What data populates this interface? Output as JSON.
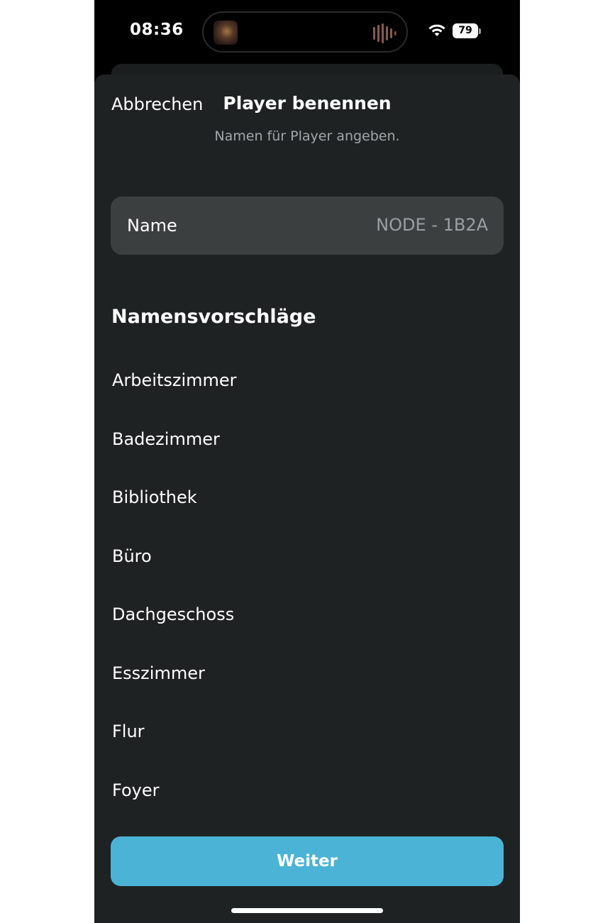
{
  "status_bar": {
    "time": "08:36",
    "battery": "79",
    "now_playing_artwork_icon": "album-art-icon",
    "waveform_icon": "audio-waveform-icon",
    "wifi_icon": "wifi-icon"
  },
  "sheet": {
    "cancel_label": "Abbrechen",
    "title": "Player benennen",
    "subtitle": "Namen für Player angeben."
  },
  "name_field": {
    "label": "Name",
    "placeholder": "NODE - 1B2A"
  },
  "suggestions": {
    "heading": "Namensvorschläge",
    "items": [
      "Arbeitszimmer",
      "Badezimmer",
      "Bibliothek",
      "Büro",
      "Dachgeschoss",
      "Esszimmer",
      "Flur",
      "Foyer"
    ]
  },
  "footer": {
    "continue_label": "Weiter"
  },
  "colors": {
    "sheet_background": "#1f2223",
    "field_background": "#3b3f40",
    "accent": "#4ab3d6",
    "secondary_text": "#a3a7a9"
  }
}
